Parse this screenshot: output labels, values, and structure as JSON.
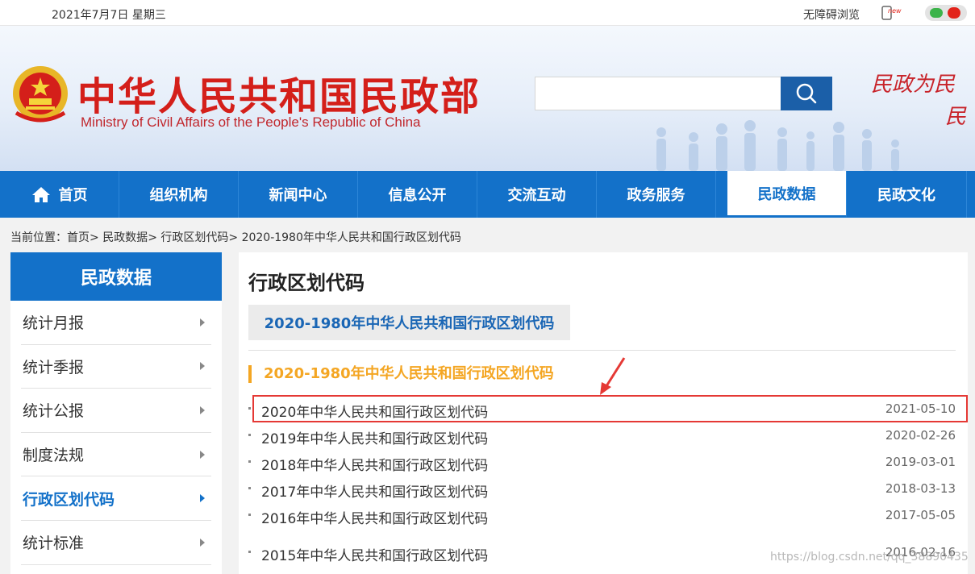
{
  "topbar": {
    "date": "2021年7月7日 星期三",
    "accessibility": "无障碍浏览",
    "new_badge": "new"
  },
  "header": {
    "title_cn": "中华人民共和国民政部",
    "title_en": "Ministry of Civil Affairs of the People's Republic of China",
    "search_placeholder": "",
    "slogan_line1": "民政为民",
    "slogan_line2": "民"
  },
  "nav": {
    "items": [
      {
        "label": "首页"
      },
      {
        "label": "组织机构"
      },
      {
        "label": "新闻中心"
      },
      {
        "label": "信息公开"
      },
      {
        "label": "交流互动"
      },
      {
        "label": "政务服务"
      },
      {
        "label": "民政数据"
      },
      {
        "label": "民政文化"
      }
    ],
    "active_index": 6
  },
  "breadcrumb": {
    "prefix": "当前位置：",
    "items": [
      "首页",
      "民政数据",
      "行政区划代码",
      "2020-1980年中华人民共和国行政区划代码"
    ],
    "sep": "> "
  },
  "sidebar": {
    "title": "民政数据",
    "items": [
      {
        "label": "统计月报"
      },
      {
        "label": "统计季报"
      },
      {
        "label": "统计公报"
      },
      {
        "label": "制度法规"
      },
      {
        "label": "行政区划代码"
      },
      {
        "label": "统计标准"
      }
    ],
    "active_index": 4
  },
  "main": {
    "page_title": "行政区划代码",
    "tab_label": "2020-1980年中华人民共和国行政区划代码",
    "section_title": "2020-1980年中华人民共和国行政区划代码",
    "rows": [
      {
        "title": "2020年中华人民共和国行政区划代码",
        "date": "2021-05-10"
      },
      {
        "title": "2019年中华人民共和国行政区划代码",
        "date": "2020-02-26"
      },
      {
        "title": "2018年中华人民共和国行政区划代码",
        "date": "2019-03-01"
      },
      {
        "title": "2017年中华人民共和国行政区划代码",
        "date": "2018-03-13"
      },
      {
        "title": "2016年中华人民共和国行政区划代码",
        "date": "2017-05-05"
      },
      {
        "title": "2015年中华人民共和国行政区划代码",
        "date": "2016-02-16"
      }
    ]
  },
  "colors": {
    "nav_blue": "#1371c9",
    "accent_orange": "#f4a623",
    "title_red": "#d41f1a",
    "highlight_red": "#e53935"
  },
  "watermark": "https://blog.csdn.net/qq_38890435"
}
